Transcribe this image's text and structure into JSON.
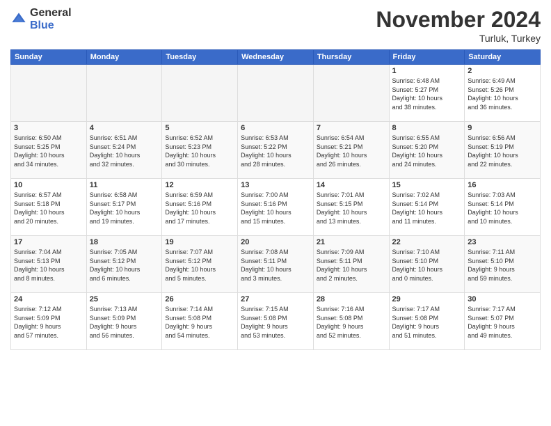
{
  "logo": {
    "general": "General",
    "blue": "Blue"
  },
  "title": "November 2024",
  "location": "Turluk, Turkey",
  "headers": [
    "Sunday",
    "Monday",
    "Tuesday",
    "Wednesday",
    "Thursday",
    "Friday",
    "Saturday"
  ],
  "weeks": [
    [
      {
        "day": "",
        "info": ""
      },
      {
        "day": "",
        "info": ""
      },
      {
        "day": "",
        "info": ""
      },
      {
        "day": "",
        "info": ""
      },
      {
        "day": "",
        "info": ""
      },
      {
        "day": "1",
        "info": "Sunrise: 6:48 AM\nSunset: 5:27 PM\nDaylight: 10 hours\nand 38 minutes."
      },
      {
        "day": "2",
        "info": "Sunrise: 6:49 AM\nSunset: 5:26 PM\nDaylight: 10 hours\nand 36 minutes."
      }
    ],
    [
      {
        "day": "3",
        "info": "Sunrise: 6:50 AM\nSunset: 5:25 PM\nDaylight: 10 hours\nand 34 minutes."
      },
      {
        "day": "4",
        "info": "Sunrise: 6:51 AM\nSunset: 5:24 PM\nDaylight: 10 hours\nand 32 minutes."
      },
      {
        "day": "5",
        "info": "Sunrise: 6:52 AM\nSunset: 5:23 PM\nDaylight: 10 hours\nand 30 minutes."
      },
      {
        "day": "6",
        "info": "Sunrise: 6:53 AM\nSunset: 5:22 PM\nDaylight: 10 hours\nand 28 minutes."
      },
      {
        "day": "7",
        "info": "Sunrise: 6:54 AM\nSunset: 5:21 PM\nDaylight: 10 hours\nand 26 minutes."
      },
      {
        "day": "8",
        "info": "Sunrise: 6:55 AM\nSunset: 5:20 PM\nDaylight: 10 hours\nand 24 minutes."
      },
      {
        "day": "9",
        "info": "Sunrise: 6:56 AM\nSunset: 5:19 PM\nDaylight: 10 hours\nand 22 minutes."
      }
    ],
    [
      {
        "day": "10",
        "info": "Sunrise: 6:57 AM\nSunset: 5:18 PM\nDaylight: 10 hours\nand 20 minutes."
      },
      {
        "day": "11",
        "info": "Sunrise: 6:58 AM\nSunset: 5:17 PM\nDaylight: 10 hours\nand 19 minutes."
      },
      {
        "day": "12",
        "info": "Sunrise: 6:59 AM\nSunset: 5:16 PM\nDaylight: 10 hours\nand 17 minutes."
      },
      {
        "day": "13",
        "info": "Sunrise: 7:00 AM\nSunset: 5:16 PM\nDaylight: 10 hours\nand 15 minutes."
      },
      {
        "day": "14",
        "info": "Sunrise: 7:01 AM\nSunset: 5:15 PM\nDaylight: 10 hours\nand 13 minutes."
      },
      {
        "day": "15",
        "info": "Sunrise: 7:02 AM\nSunset: 5:14 PM\nDaylight: 10 hours\nand 11 minutes."
      },
      {
        "day": "16",
        "info": "Sunrise: 7:03 AM\nSunset: 5:14 PM\nDaylight: 10 hours\nand 10 minutes."
      }
    ],
    [
      {
        "day": "17",
        "info": "Sunrise: 7:04 AM\nSunset: 5:13 PM\nDaylight: 10 hours\nand 8 minutes."
      },
      {
        "day": "18",
        "info": "Sunrise: 7:05 AM\nSunset: 5:12 PM\nDaylight: 10 hours\nand 6 minutes."
      },
      {
        "day": "19",
        "info": "Sunrise: 7:07 AM\nSunset: 5:12 PM\nDaylight: 10 hours\nand 5 minutes."
      },
      {
        "day": "20",
        "info": "Sunrise: 7:08 AM\nSunset: 5:11 PM\nDaylight: 10 hours\nand 3 minutes."
      },
      {
        "day": "21",
        "info": "Sunrise: 7:09 AM\nSunset: 5:11 PM\nDaylight: 10 hours\nand 2 minutes."
      },
      {
        "day": "22",
        "info": "Sunrise: 7:10 AM\nSunset: 5:10 PM\nDaylight: 10 hours\nand 0 minutes."
      },
      {
        "day": "23",
        "info": "Sunrise: 7:11 AM\nSunset: 5:10 PM\nDaylight: 9 hours\nand 59 minutes."
      }
    ],
    [
      {
        "day": "24",
        "info": "Sunrise: 7:12 AM\nSunset: 5:09 PM\nDaylight: 9 hours\nand 57 minutes."
      },
      {
        "day": "25",
        "info": "Sunrise: 7:13 AM\nSunset: 5:09 PM\nDaylight: 9 hours\nand 56 minutes."
      },
      {
        "day": "26",
        "info": "Sunrise: 7:14 AM\nSunset: 5:08 PM\nDaylight: 9 hours\nand 54 minutes."
      },
      {
        "day": "27",
        "info": "Sunrise: 7:15 AM\nSunset: 5:08 PM\nDaylight: 9 hours\nand 53 minutes."
      },
      {
        "day": "28",
        "info": "Sunrise: 7:16 AM\nSunset: 5:08 PM\nDaylight: 9 hours\nand 52 minutes."
      },
      {
        "day": "29",
        "info": "Sunrise: 7:17 AM\nSunset: 5:08 PM\nDaylight: 9 hours\nand 51 minutes."
      },
      {
        "day": "30",
        "info": "Sunrise: 7:17 AM\nSunset: 5:07 PM\nDaylight: 9 hours\nand 49 minutes."
      }
    ]
  ]
}
